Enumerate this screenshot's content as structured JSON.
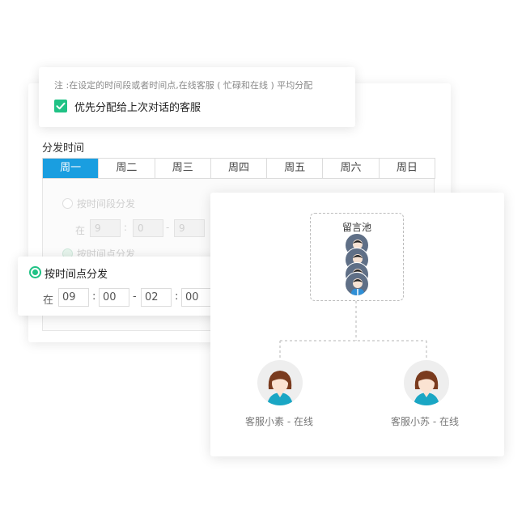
{
  "note_card": {
    "note": "注 :在设定的时间段或者时间点,在线客服 ( 忙碌和在线 ) 平均分配",
    "checkbox_label": "优先分配给上次对话的客服",
    "checkbox_checked": true,
    "accent_color": "#20c285"
  },
  "settings": {
    "section_label": "分发时间",
    "tabs": [
      "周一",
      "周二",
      "周三",
      "周四",
      "周五",
      "周六",
      "周日"
    ],
    "active_tab": "周一",
    "tab_active_color": "#1a9ee0",
    "faded": {
      "option_period": "按时间段分发",
      "in": "在",
      "v1": "9",
      "v2": "0",
      "v3": "9",
      "option_point": "按时间点分发"
    }
  },
  "time_point": {
    "option_label": "按时间点分发",
    "in_label": "在",
    "start_hour": "09",
    "start_minute": "00",
    "end_hour": "02",
    "end_minute": "00",
    "colon": ":",
    "dash": "-"
  },
  "pool": {
    "title": "留言池",
    "agents": [
      {
        "label": "客服小素 - 在线",
        "icon": "female-agent-avatar"
      },
      {
        "label": "客服小苏 - 在线",
        "icon": "female-agent-avatar"
      }
    ]
  }
}
